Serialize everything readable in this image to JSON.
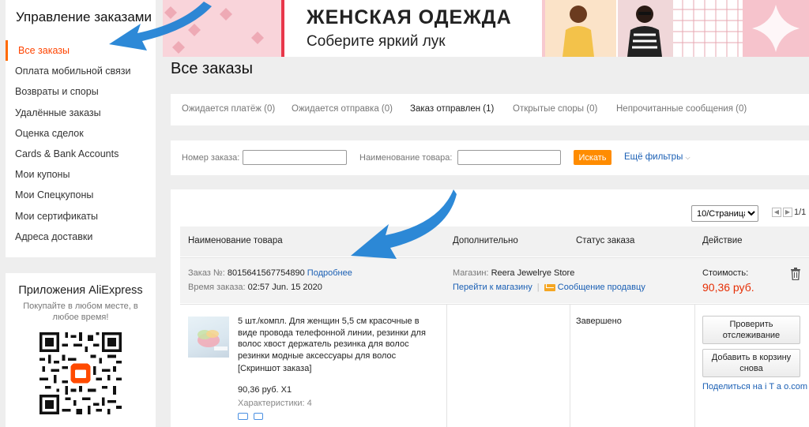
{
  "sidebar": {
    "title": "Управление заказами",
    "items": [
      {
        "label": "Все заказы"
      },
      {
        "label": "Оплата мобильной связи"
      },
      {
        "label": "Возвраты и споры"
      },
      {
        "label": "Удалённые заказы"
      },
      {
        "label": "Оценка сделок"
      },
      {
        "label": "Cards & Bank Accounts"
      },
      {
        "label": "Мои купоны"
      },
      {
        "label": "Мои Спецкупоны"
      },
      {
        "label": "Мои сертификаты"
      },
      {
        "label": "Адреса доставки"
      }
    ]
  },
  "apps": {
    "title": "Приложения AliExpress",
    "subtitle": "Покупайте в любом месте, в любое время!"
  },
  "banner": {
    "title": "ЖЕНСКАЯ ОДЕЖДА",
    "subtitle": "Соберите яркий лук"
  },
  "page": {
    "title": "Все заказы"
  },
  "tabs": [
    {
      "label": "Ожидается платёж (0)"
    },
    {
      "label": "Ожидается отправка (0)"
    },
    {
      "label": "Заказ отправлен (1)"
    },
    {
      "label": "Открытые споры (0)"
    },
    {
      "label": "Непрочитанные сообщения (0)"
    }
  ],
  "search": {
    "order_label": "Номер заказа:",
    "order_value": "",
    "product_label": "Наименование товара:",
    "product_value": "",
    "button": "Искать",
    "more_filters": "Ещё фильтры"
  },
  "pagination": {
    "per_page": "10/Страница",
    "page_text": "1/1"
  },
  "table": {
    "headers": {
      "product": "Наименование товара",
      "extra": "Дополнительно",
      "status": "Статус заказа",
      "action": "Действие"
    }
  },
  "order": {
    "number_label": "Заказ №:",
    "number": "8015641567754890",
    "details_link": "Подробнее",
    "time_label": "Время заказа:",
    "time": "02:57 Jun. 15 2020",
    "store_label": "Магазин:",
    "store": "Reera Jewelrye Store",
    "store_link": "Перейти к магазину",
    "separator": "|",
    "message_link": "Сообщение продавцу",
    "cost_label": "Стоимость:",
    "cost": "90,36 руб.",
    "product": {
      "name": "5 шт./компл. Для женщин 5,5 см красочные в виде провода телефонной линии, резинки для волос хвост держатель резинка для волос резинки модные аксессуары для волос",
      "screenshot_link": "[Скриншот заказа]",
      "price_qty": "90,36 руб. X1",
      "specs_label": "Характеристики: 4"
    },
    "status": "Завершено",
    "actions": {
      "track": "Проверить отслеживание",
      "add_to_cart": "Добавить в корзину снова",
      "share_prefix": "Поделиться на ",
      "share_site": "i T a o.com"
    }
  },
  "colors": {
    "accent": "#ff6a00",
    "link": "#1a5fb4",
    "price": "#e62e04",
    "button": "#ff8c00"
  }
}
